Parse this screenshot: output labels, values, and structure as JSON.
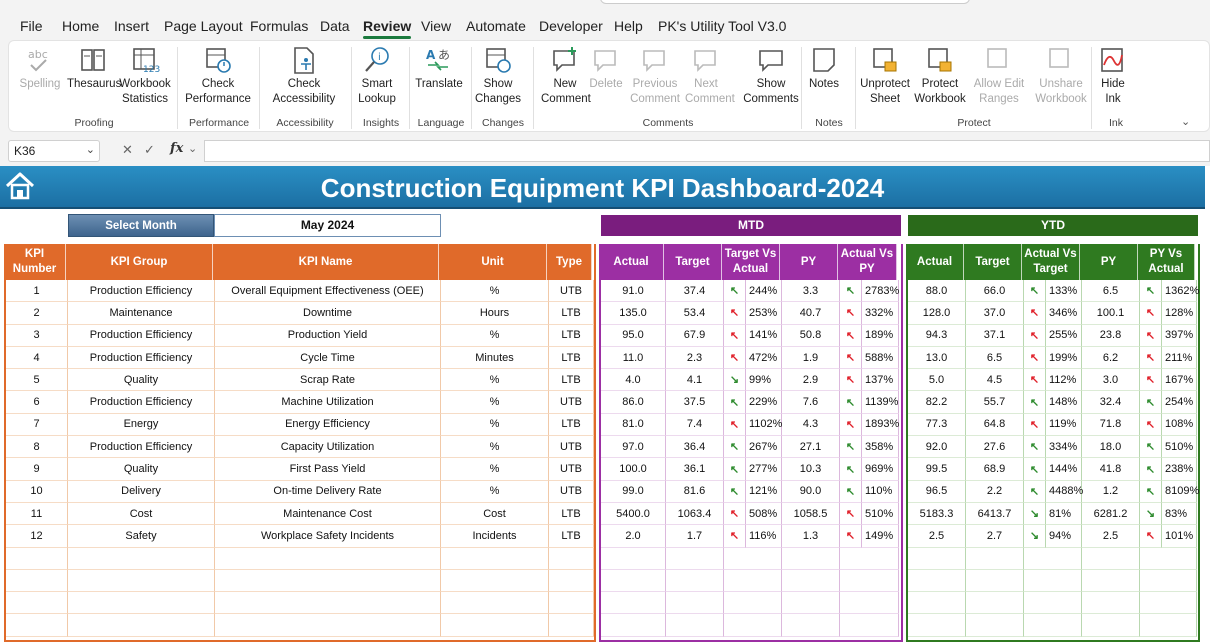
{
  "menu": {
    "tabs": [
      "File",
      "Home",
      "Insert",
      "Page Layout",
      "Formulas",
      "Data",
      "Review",
      "View",
      "Automate",
      "Developer",
      "Help",
      "PK's Utility Tool V3.0"
    ],
    "active": "Review"
  },
  "ribbon": {
    "buttons": [
      {
        "label": "Spelling",
        "icon": "spelling-icon",
        "disabled": true
      },
      {
        "label": "Thesaurus",
        "icon": "thesaurus-icon",
        "disabled": false
      },
      {
        "label": "Workbook Statistics",
        "icon": "workbook-statistics-icon",
        "disabled": false
      },
      {
        "label": "Check Performance",
        "icon": "check-performance-icon",
        "disabled": false
      },
      {
        "label": "Check Accessibility",
        "icon": "check-accessibility-icon",
        "disabled": false
      },
      {
        "label": "Smart Lookup",
        "icon": "smart-lookup-icon",
        "disabled": false
      },
      {
        "label": "Translate",
        "icon": "translate-icon",
        "disabled": false
      },
      {
        "label": "Show Changes",
        "icon": "show-changes-icon",
        "disabled": false
      },
      {
        "label": "New Comment",
        "icon": "new-comment-icon",
        "disabled": false
      },
      {
        "label": "Delete",
        "icon": "delete-comment-icon",
        "disabled": true
      },
      {
        "label": "Previous Comment",
        "icon": "previous-comment-icon",
        "disabled": true
      },
      {
        "label": "Next Comment",
        "icon": "next-comment-icon",
        "disabled": true
      },
      {
        "label": "Show Comments",
        "icon": "show-comments-icon",
        "disabled": false
      },
      {
        "label": "Notes",
        "icon": "notes-icon",
        "disabled": false
      },
      {
        "label": "Unprotect Sheet",
        "icon": "unprotect-sheet-icon",
        "disabled": false
      },
      {
        "label": "Protect Workbook",
        "icon": "protect-workbook-icon",
        "disabled": false
      },
      {
        "label": "Allow Edit Ranges",
        "icon": "allow-edit-ranges-icon",
        "disabled": true
      },
      {
        "label": "Unshare Workbook",
        "icon": "unshare-workbook-icon",
        "disabled": true
      },
      {
        "label": "Hide Ink",
        "icon": "hide-ink-icon",
        "disabled": false
      }
    ],
    "groups": [
      "Proofing",
      "Performance",
      "Accessibility",
      "Insights",
      "Language",
      "Changes",
      "Comments",
      "Notes",
      "Protect",
      "Ink"
    ]
  },
  "formula_bar": {
    "name_box": "K36",
    "fx": "fx"
  },
  "dashboard": {
    "title": "Construction Equipment KPI Dashboard-2024",
    "select_month_label": "Select Month",
    "select_month_value": "May 2024",
    "mtd_label": "MTD",
    "ytd_label": "YTD",
    "colors": {
      "title": "#1f7ab0",
      "left_header": "#e06a2a",
      "mtd_header": "#9c2fa3",
      "ytd_header": "#2f7a20",
      "arrow_up": "#2e8b2e",
      "arrow_down": "#e0202a"
    },
    "left_headers": [
      "KPI Number",
      "KPI Group",
      "KPI Name",
      "Unit",
      "Type"
    ],
    "mtd_headers": [
      "Actual",
      "Target",
      "Target Vs Actual",
      "PY",
      "Actual Vs PY"
    ],
    "ytd_headers": [
      "Actual",
      "Target",
      "Actual Vs Target",
      "PY",
      "PY Vs Actual"
    ],
    "rows": [
      {
        "num": "1",
        "group": "Production Efficiency",
        "name": "Overall Equipment Effectiveness (OEE)",
        "unit": "%",
        "type": "UTB",
        "mtd": {
          "actual": "91.0",
          "target": "37.4",
          "tva_dir": "up",
          "tva": "244%",
          "py": "3.3",
          "avp_dir": "up",
          "avp": "2783%"
        },
        "ytd": {
          "actual": "88.0",
          "target": "66.0",
          "avt_dir": "up",
          "avt": "133%",
          "py": "6.5",
          "pva_dir": "up",
          "pva": "1362%"
        }
      },
      {
        "num": "2",
        "group": "Maintenance",
        "name": "Downtime",
        "unit": "Hours",
        "type": "LTB",
        "mtd": {
          "actual": "135.0",
          "target": "53.4",
          "tva_dir": "down",
          "tva": "253%",
          "py": "40.7",
          "avp_dir": "down",
          "avp": "332%"
        },
        "ytd": {
          "actual": "128.0",
          "target": "37.0",
          "avt_dir": "down",
          "avt": "346%",
          "py": "100.1",
          "pva_dir": "down",
          "pva": "128%"
        }
      },
      {
        "num": "3",
        "group": "Production Efficiency",
        "name": "Production Yield",
        "unit": "%",
        "type": "LTB",
        "mtd": {
          "actual": "95.0",
          "target": "67.9",
          "tva_dir": "down",
          "tva": "141%",
          "py": "50.8",
          "avp_dir": "down",
          "avp": "189%"
        },
        "ytd": {
          "actual": "94.3",
          "target": "37.1",
          "avt_dir": "down",
          "avt": "255%",
          "py": "23.8",
          "pva_dir": "down",
          "pva": "397%"
        }
      },
      {
        "num": "4",
        "group": "Production Efficiency",
        "name": "Cycle Time",
        "unit": "Minutes",
        "type": "LTB",
        "mtd": {
          "actual": "11.0",
          "target": "2.3",
          "tva_dir": "down",
          "tva": "472%",
          "py": "1.9",
          "avp_dir": "down",
          "avp": "588%"
        },
        "ytd": {
          "actual": "13.0",
          "target": "6.5",
          "avt_dir": "down",
          "avt": "199%",
          "py": "6.2",
          "pva_dir": "down",
          "pva": "211%"
        }
      },
      {
        "num": "5",
        "group": "Quality",
        "name": "Scrap Rate",
        "unit": "%",
        "type": "LTB",
        "mtd": {
          "actual": "4.0",
          "target": "4.1",
          "tva_dir": "upok",
          "tva": "99%",
          "py": "2.9",
          "avp_dir": "down",
          "avp": "137%"
        },
        "ytd": {
          "actual": "5.0",
          "target": "4.5",
          "avt_dir": "down",
          "avt": "112%",
          "py": "3.0",
          "pva_dir": "down",
          "pva": "167%"
        }
      },
      {
        "num": "6",
        "group": "Production Efficiency",
        "name": "Machine Utilization",
        "unit": "%",
        "type": "UTB",
        "mtd": {
          "actual": "86.0",
          "target": "37.5",
          "tva_dir": "up",
          "tva": "229%",
          "py": "7.6",
          "avp_dir": "up",
          "avp": "1139%"
        },
        "ytd": {
          "actual": "82.2",
          "target": "55.7",
          "avt_dir": "up",
          "avt": "148%",
          "py": "32.4",
          "pva_dir": "up",
          "pva": "254%"
        }
      },
      {
        "num": "7",
        "group": "Energy",
        "name": "Energy Efficiency",
        "unit": "%",
        "type": "LTB",
        "mtd": {
          "actual": "81.0",
          "target": "7.4",
          "tva_dir": "down",
          "tva": "1102%",
          "py": "4.3",
          "avp_dir": "down",
          "avp": "1893%"
        },
        "ytd": {
          "actual": "77.3",
          "target": "64.8",
          "avt_dir": "down",
          "avt": "119%",
          "py": "71.8",
          "pva_dir": "down",
          "pva": "108%"
        }
      },
      {
        "num": "8",
        "group": "Production Efficiency",
        "name": "Capacity Utilization",
        "unit": "%",
        "type": "UTB",
        "mtd": {
          "actual": "97.0",
          "target": "36.4",
          "tva_dir": "up",
          "tva": "267%",
          "py": "27.1",
          "avp_dir": "up",
          "avp": "358%"
        },
        "ytd": {
          "actual": "92.0",
          "target": "27.6",
          "avt_dir": "up",
          "avt": "334%",
          "py": "18.0",
          "pva_dir": "up",
          "pva": "510%"
        }
      },
      {
        "num": "9",
        "group": "Quality",
        "name": "First Pass Yield",
        "unit": "%",
        "type": "UTB",
        "mtd": {
          "actual": "100.0",
          "target": "36.1",
          "tva_dir": "up",
          "tva": "277%",
          "py": "10.3",
          "avp_dir": "up",
          "avp": "969%"
        },
        "ytd": {
          "actual": "99.5",
          "target": "68.9",
          "avt_dir": "up",
          "avt": "144%",
          "py": "41.8",
          "pva_dir": "up",
          "pva": "238%"
        }
      },
      {
        "num": "10",
        "group": "Delivery",
        "name": "On-time Delivery Rate",
        "unit": "%",
        "type": "UTB",
        "mtd": {
          "actual": "99.0",
          "target": "81.6",
          "tva_dir": "up",
          "tva": "121%",
          "py": "90.0",
          "avp_dir": "up",
          "avp": "110%"
        },
        "ytd": {
          "actual": "96.5",
          "target": "2.2",
          "avt_dir": "up",
          "avt": "4488%",
          "py": "1.2",
          "pva_dir": "up",
          "pva": "8109%"
        }
      },
      {
        "num": "11",
        "group": "Cost",
        "name": "Maintenance Cost",
        "unit": "Cost",
        "type": "LTB",
        "mtd": {
          "actual": "5400.0",
          "target": "1063.4",
          "tva_dir": "down",
          "tva": "508%",
          "py": "1058.5",
          "avp_dir": "down",
          "avp": "510%"
        },
        "ytd": {
          "actual": "5183.3",
          "target": "6413.7",
          "avt_dir": "upok",
          "avt": "81%",
          "py": "6281.2",
          "pva_dir": "upok",
          "pva": "83%"
        }
      },
      {
        "num": "12",
        "group": "Safety",
        "name": "Workplace Safety Incidents",
        "unit": "Incidents",
        "type": "LTB",
        "mtd": {
          "actual": "2.0",
          "target": "1.7",
          "tva_dir": "down",
          "tva": "116%",
          "py": "1.3",
          "avp_dir": "down",
          "avp": "149%"
        },
        "ytd": {
          "actual": "2.5",
          "target": "2.7",
          "avt_dir": "upok",
          "avt": "94%",
          "py": "2.5",
          "pva_dir": "down",
          "pva": "101%"
        }
      }
    ]
  }
}
